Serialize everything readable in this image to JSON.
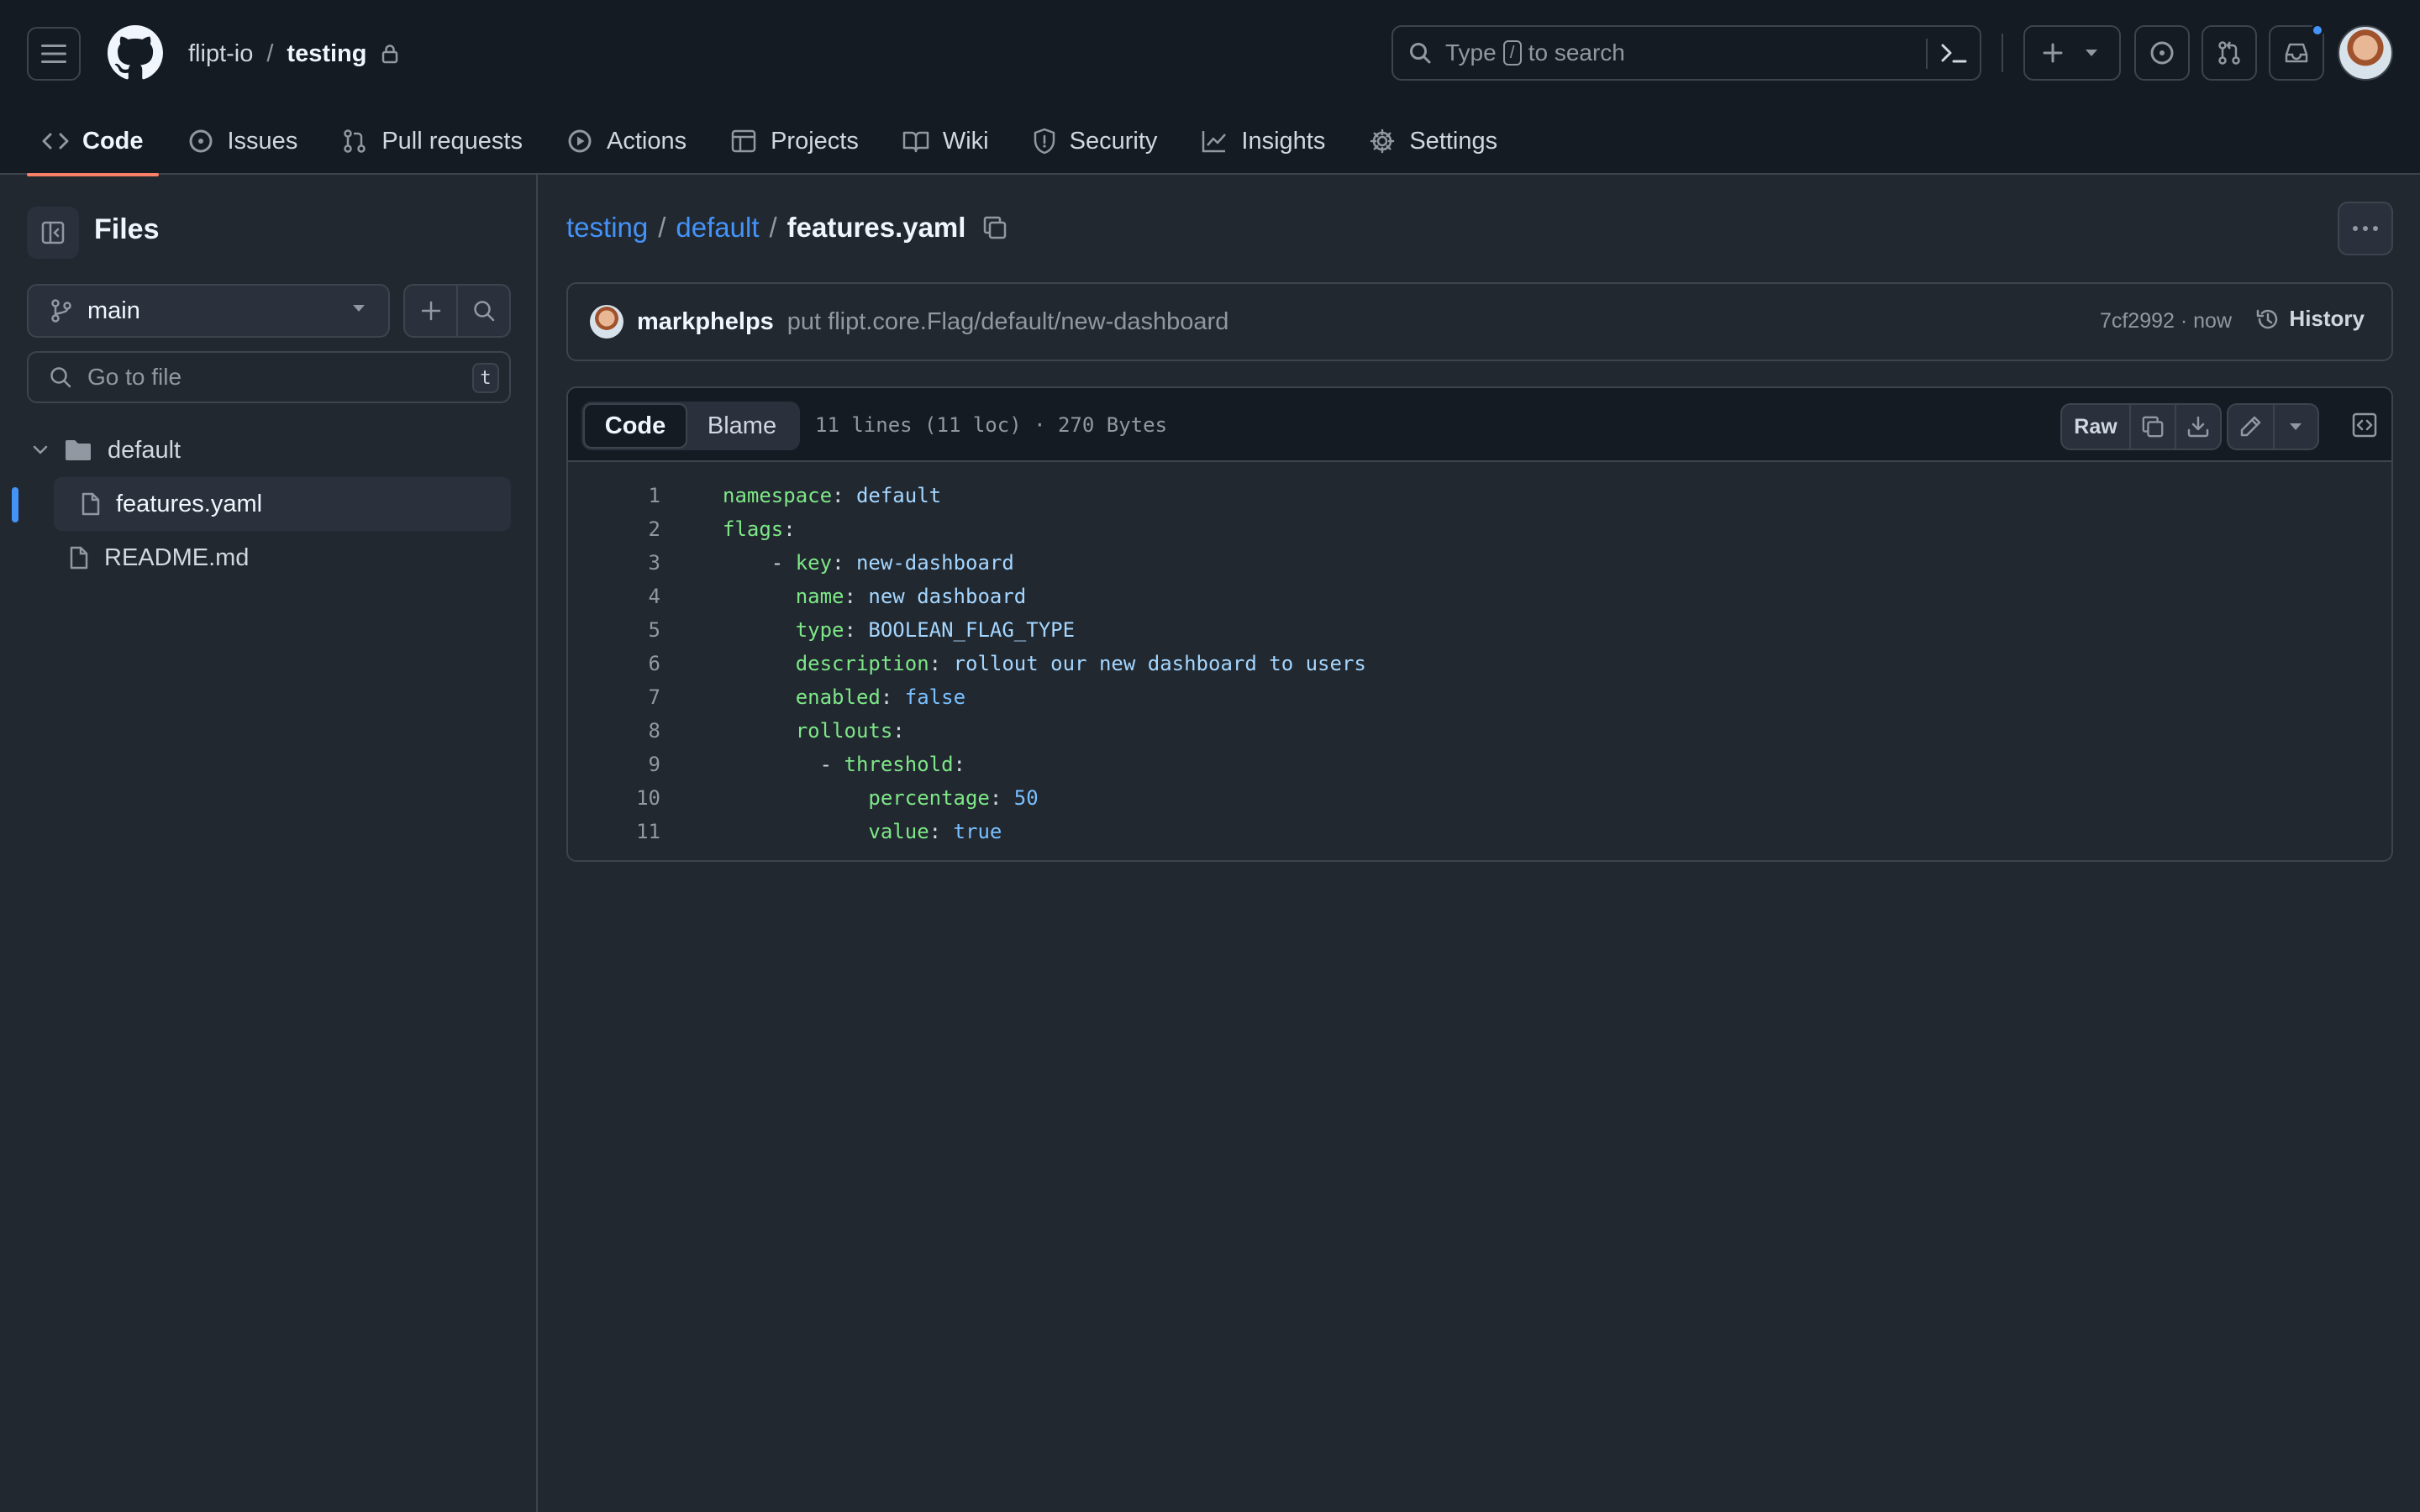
{
  "header": {
    "owner": "flipt-io",
    "separator": "/",
    "repo": "testing",
    "search": {
      "prefix": "Type",
      "key": "/",
      "suffix": "to search"
    },
    "tabs": [
      {
        "label": "Code",
        "icon": "code-icon",
        "active": true
      },
      {
        "label": "Issues",
        "icon": "issue-opened-icon"
      },
      {
        "label": "Pull requests",
        "icon": "git-pull-request-icon"
      },
      {
        "label": "Actions",
        "icon": "play-icon"
      },
      {
        "label": "Projects",
        "icon": "table-icon"
      },
      {
        "label": "Wiki",
        "icon": "book-icon"
      },
      {
        "label": "Security",
        "icon": "shield-icon"
      },
      {
        "label": "Insights",
        "icon": "graph-icon"
      },
      {
        "label": "Settings",
        "icon": "gear-icon"
      }
    ],
    "accent": "#f78166",
    "notification_color": "#4493f8"
  },
  "sidebar": {
    "title": "Files",
    "branch": "main",
    "goto_placeholder": "Go to file",
    "goto_key": "t",
    "tree": {
      "folder": "default",
      "nested_file": "features.yaml",
      "top_file": "README.md"
    }
  },
  "main": {
    "breadcrumb": {
      "repo": "testing",
      "sep1": "/",
      "folder": "default",
      "sep2": "/",
      "file": "features.yaml"
    },
    "commit": {
      "author": "markphelps",
      "message": "put flipt.core.Flag/default/new-dashboard",
      "meta": "7cf2992 · now",
      "history_label": "History"
    },
    "toolbar": {
      "code_tab": "Code",
      "blame_tab": "Blame",
      "file_info": "11 lines (11 loc) · 270 Bytes",
      "raw_label": "Raw"
    },
    "code_lines": [
      {
        "n": "1",
        "indent": "",
        "dash": "",
        "key": "namespace",
        "value": "default",
        "vtype": "v"
      },
      {
        "n": "2",
        "indent": "",
        "dash": "",
        "key": "flags",
        "value": "",
        "vtype": "v"
      },
      {
        "n": "3",
        "indent": "    ",
        "dash": "- ",
        "key": "key",
        "value": "new-dashboard",
        "vtype": "v"
      },
      {
        "n": "4",
        "indent": "      ",
        "dash": "",
        "key": "name",
        "value": "new dashboard",
        "vtype": "v"
      },
      {
        "n": "5",
        "indent": "      ",
        "dash": "",
        "key": "type",
        "value": "BOOLEAN_FLAG_TYPE",
        "vtype": "v"
      },
      {
        "n": "6",
        "indent": "      ",
        "dash": "",
        "key": "description",
        "value": "rollout our new dashboard to users",
        "vtype": "v"
      },
      {
        "n": "7",
        "indent": "      ",
        "dash": "",
        "key": "enabled",
        "value": "false",
        "vtype": "c"
      },
      {
        "n": "8",
        "indent": "      ",
        "dash": "",
        "key": "rollouts",
        "value": "",
        "vtype": "v"
      },
      {
        "n": "9",
        "indent": "        ",
        "dash": "- ",
        "key": "threshold",
        "value": "",
        "vtype": "v"
      },
      {
        "n": "10",
        "indent": "            ",
        "dash": "",
        "key": "percentage",
        "value": "50",
        "vtype": "c"
      },
      {
        "n": "11",
        "indent": "            ",
        "dash": "",
        "key": "value",
        "value": "true",
        "vtype": "c"
      }
    ],
    "syntax_colors": {
      "key": "#7ee787",
      "string": "#a5d6ff",
      "constant": "#79c0ff"
    }
  }
}
